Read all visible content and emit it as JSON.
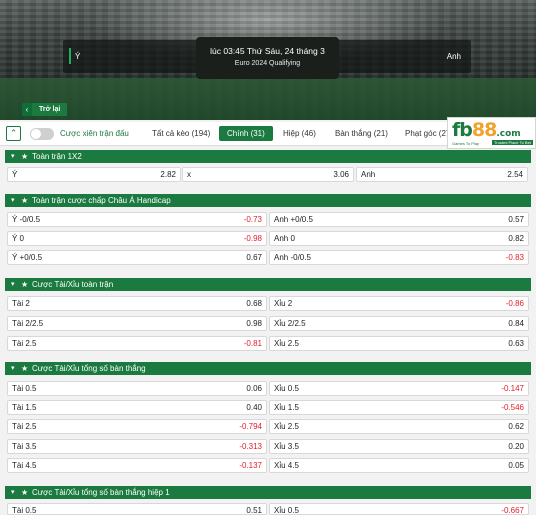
{
  "match": {
    "home": "Ý",
    "away": "Anh",
    "datetime": "lúc 03:45 Thứ Sáu, 24 tháng 3",
    "competition": "Euro 2024 Qualifying"
  },
  "back": {
    "label": "Trở lại"
  },
  "tabbar": {
    "toggle_label": "Cược xiên trận đấu",
    "tabs": [
      {
        "label": "Tất cả kèo (194)"
      },
      {
        "label": "Chính (31)"
      },
      {
        "label": "Hiệp (46)"
      },
      {
        "label": "Bàn thắng (21)"
      },
      {
        "label": "Phạt góc (27"
      }
    ],
    "active_tab": "Chính (31)"
  },
  "logo": {
    "main": "fb",
    "num": "88",
    "com": ".com",
    "tagline": "Games To Play",
    "tagline2": "Trusted Place To Bet"
  },
  "sections": [
    {
      "title": "Toàn trận 1X2",
      "rows": [
        [
          {
            "label": "Ý",
            "value": "2.82"
          },
          {
            "label": "x",
            "value": "3.06"
          },
          {
            "label": "Anh",
            "value": "2.54"
          }
        ]
      ]
    },
    {
      "title": "Toàn trận cược chấp Châu Á Handicap",
      "rows": [
        [
          {
            "label": "Ý -0/0.5",
            "value": "-0.73"
          },
          {
            "label": "Anh +0/0.5",
            "value": "0.57"
          }
        ],
        [
          {
            "label": "Ý 0",
            "value": "-0.98"
          },
          {
            "label": "Anh 0",
            "value": "0.82"
          }
        ],
        [
          {
            "label": "Ý +0/0.5",
            "value": "0.67"
          },
          {
            "label": "Anh -0/0.5",
            "value": "-0.83"
          }
        ]
      ]
    },
    {
      "title": "Cược Tài/Xỉu toàn trận",
      "rows": [
        [
          {
            "label": "Tài 2",
            "value": "0.68"
          },
          {
            "label": "Xỉu 2",
            "value": "-0.86"
          }
        ],
        [
          {
            "label": "Tài 2/2.5",
            "value": "0.98"
          },
          {
            "label": "Xỉu 2/2.5",
            "value": "0.84"
          }
        ],
        [
          {
            "label": "Tài 2.5",
            "value": "-0.81"
          },
          {
            "label": "Xỉu 2.5",
            "value": "0.63"
          }
        ]
      ]
    },
    {
      "title": "Cược Tài/Xỉu tổng số bàn thắng",
      "rows": [
        [
          {
            "label": "Tài 0.5",
            "value": "0.06"
          },
          {
            "label": "Xỉu 0.5",
            "value": "-0.147"
          }
        ],
        [
          {
            "label": "Tài 1.5",
            "value": "0.40"
          },
          {
            "label": "Xỉu 1.5",
            "value": "-0.546"
          }
        ],
        [
          {
            "label": "Tài 2.5",
            "value": "-0.794"
          },
          {
            "label": "Xỉu 2.5",
            "value": "0.62"
          }
        ],
        [
          {
            "label": "Tài 3.5",
            "value": "-0.313"
          },
          {
            "label": "Xỉu 3.5",
            "value": "0.20"
          }
        ],
        [
          {
            "label": "Tài 4.5",
            "value": "-0.137"
          },
          {
            "label": "Xỉu 4.5",
            "value": "0.05"
          }
        ]
      ]
    },
    {
      "title": "Cược Tài/Xỉu tổng số bàn thắng hiệp 1",
      "rows": [
        [
          {
            "label": "Tài 0.5",
            "value": "0.51"
          },
          {
            "label": "Xỉu 0.5",
            "value": "-0.667"
          }
        ]
      ]
    }
  ],
  "colors": {
    "green": "#1b7a3f",
    "negative": "#e0202a",
    "logo_orange": "#f2a12b"
  }
}
